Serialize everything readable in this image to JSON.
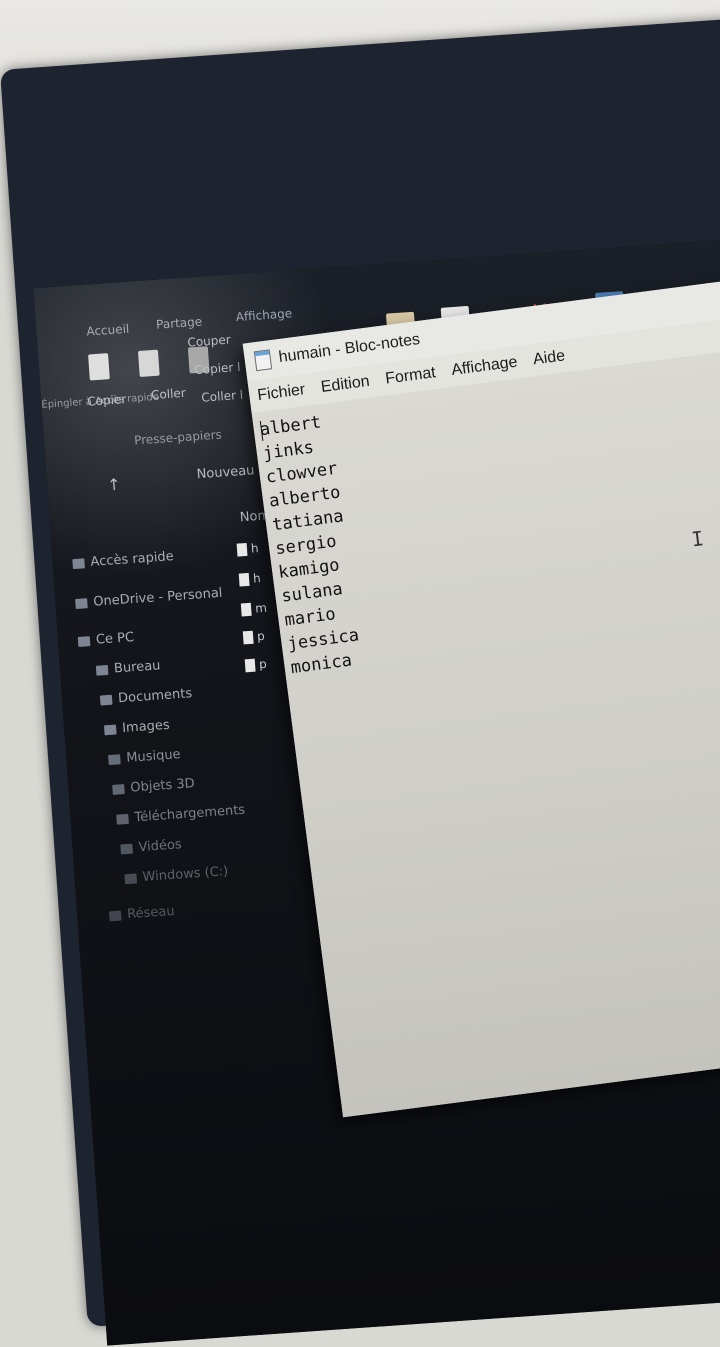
{
  "explorer": {
    "ribbon_tabs": [
      "Accueil",
      "Partage",
      "Affichage"
    ],
    "clipboard": {
      "cut": "Couper",
      "copy_path": "Copier l",
      "paste_shortcut": "Coller l",
      "pin_label": "Épingler à Accès rapide",
      "copy": "Copier",
      "paste": "Coller",
      "group": "Presse-papiers"
    },
    "new_folder": "Nouveau do",
    "column_name": "Nom",
    "nav": [
      {
        "label": "Accès rapide",
        "icon": "star-icon"
      },
      {
        "label": "OneDrive - Personal",
        "icon": "cloud-icon"
      },
      {
        "label": "Ce PC",
        "icon": "computer-icon"
      },
      {
        "label": "Bureau",
        "icon": "desktop-icon"
      },
      {
        "label": "Documents",
        "icon": "documents-icon"
      },
      {
        "label": "Images",
        "icon": "images-icon"
      },
      {
        "label": "Musique",
        "icon": "music-icon"
      },
      {
        "label": "Objets 3D",
        "icon": "cube-icon"
      },
      {
        "label": "Téléchargements",
        "icon": "download-icon"
      },
      {
        "label": "Vidéos",
        "icon": "video-icon"
      },
      {
        "label": "Windows (C:)",
        "icon": "drive-icon"
      },
      {
        "label": "Réseau",
        "icon": "network-icon"
      }
    ],
    "files": [
      "h",
      "h",
      "m",
      "p",
      "p"
    ]
  },
  "notepad": {
    "title": "humain - Bloc-notes",
    "menu": [
      "Fichier",
      "Edition",
      "Format",
      "Affichage",
      "Aide"
    ],
    "lines": [
      "albert",
      "jinks",
      "clowver",
      "alberto",
      "tatiana",
      "sergio",
      "kamigo",
      "sulana",
      "mario",
      "jessica",
      "monica"
    ]
  }
}
